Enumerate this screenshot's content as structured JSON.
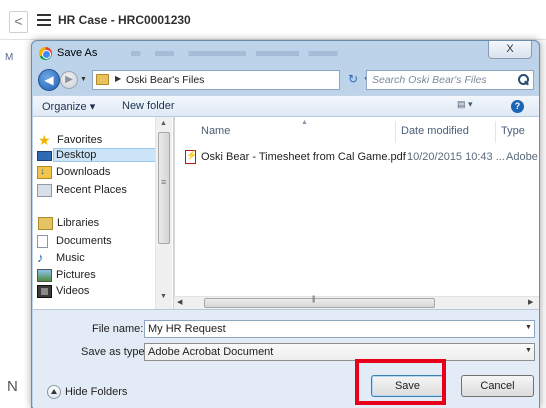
{
  "background_page": {
    "back_glyph": "<",
    "title": "HR Case - HRC0001230",
    "left_letter": "M",
    "bottom_letter": "N"
  },
  "dialog": {
    "title": "Save As",
    "close_glyph": "X",
    "address": {
      "path": "Oski Bear's Files",
      "search_placeholder": "Search Oski Bear's Files"
    },
    "toolbar": {
      "organize_label": "Organize ▾",
      "new_folder_label": "New folder",
      "views_glyph": "▤ ▾",
      "help_glyph": "?"
    },
    "nav": {
      "favorites_label": "Favorites",
      "favorites": [
        "Desktop",
        "Downloads",
        "Recent Places"
      ],
      "libraries_label": "Libraries",
      "libraries": [
        "Documents",
        "Music",
        "Pictures",
        "Videos"
      ]
    },
    "columns": {
      "name": "Name",
      "date_modified": "Date modified",
      "type": "Type"
    },
    "files": [
      {
        "name": "Oski Bear - Timesheet from Cal Game.pdf",
        "date_modified": "10/20/2015 10:43 ...",
        "type": "Adobe Ac"
      }
    ],
    "file_name_label": "File name:",
    "file_name_value": "My HR Request",
    "save_as_type_label": "Save as type:",
    "save_as_type_value": "Adobe Acrobat Document",
    "hide_folders_label": "Hide Folders",
    "save_label": "Save",
    "cancel_label": "Cancel",
    "highlight_color": "#e8001b"
  }
}
